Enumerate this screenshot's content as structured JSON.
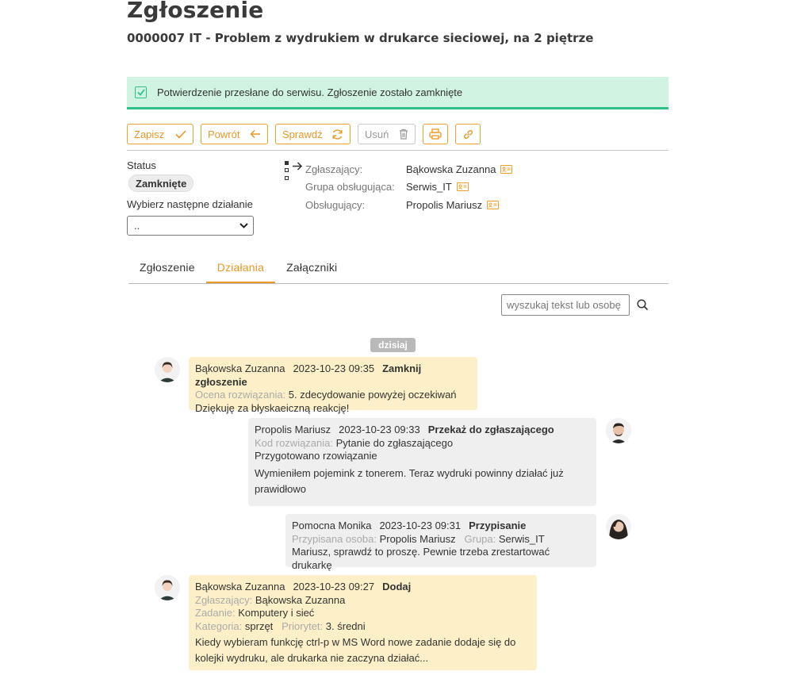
{
  "header": {
    "title": "Zgłoszenie",
    "subtitle": "0000007 IT - Problem z wydrukiem w drukarce sieciowej, na 2 piętrze"
  },
  "alert": {
    "text": "Potwierdzenie przesłane do serwisu. Zgłoszenie zostało zamknięte",
    "color": "#2fc08a"
  },
  "toolbar": {
    "save": "Zapisz",
    "back": "Powrót",
    "check": "Sprawdź",
    "delete": "Usuń",
    "accent": "#f0a030"
  },
  "status": {
    "label": "Status",
    "value": "Zamknięte",
    "next_label": "Wybierz następne działanie",
    "next_value": ".."
  },
  "people": [
    {
      "label": "Zgłaszający:",
      "value": "Bąkowska Zuzanna"
    },
    {
      "label": "Grupa obsługująca:",
      "value": "Serwis_IT"
    },
    {
      "label": "Obsługujący:",
      "value": "Propolis Mariusz"
    }
  ],
  "tabs": [
    "Zgłoszenie",
    "Działania",
    "Załączniki"
  ],
  "search": {
    "placeholder": "wyszukaj tekst lub osobę"
  },
  "timeline": {
    "date_label": "dzisiaj",
    "messages": [
      {
        "author": "Bąkowska Zuzanna",
        "time": "2023-10-23 09:35",
        "action": "Zamknij zgłoszenie",
        "l1_label": "Ocena rozwiązania:",
        "l1_value": "5. zdecydowanie powyżej oczekiwań",
        "body": "Dziękuję za błyskaeiczną reakcję!"
      },
      {
        "author": "Propolis Mariusz",
        "time": "2023-10-23 09:33",
        "action": "Przekaż do zgłaszającego",
        "l1_label": "Kod rozwiązania:",
        "l1_value": "Pytanie do zgłaszającego",
        "l2": "Przygotowano rzowiązanie",
        "body": "Wymieniłem pojemink z tonerem. Teraz wydruki powinny działać już prawidłowo"
      },
      {
        "author": "Pomocna Monika",
        "time": "2023-10-23 09:31",
        "action": "Przypisanie",
        "l1_label": "Przypisana osoba:",
        "l1_value": "Propolis Mariusz",
        "l1b_label": "Grupa:",
        "l1b_value": "Serwis_IT",
        "body": "Mariusz, sprawdź to proszę. Pewnie trzeba zrestartować drukarkę"
      },
      {
        "author": "Bąkowska Zuzanna",
        "time": "2023-10-23 09:27",
        "action": "Dodaj",
        "l1_label": "Zgłaszający:",
        "l1_value": "Bąkowska Zuzanna",
        "l2_label": "Zadanie:",
        "l2_value": "Komputery i sieć",
        "l3_label": "Kategoria:",
        "l3_value": "sprzęt",
        "l3b_label": "Priorytet:",
        "l3b_value": "3. średni",
        "body": "Kiedy wybieram funkcję ctrl-p w MS Word nowe zadanie dodaje się do kolejki wydruku, ale drukarka nie zaczyna działać..."
      }
    ]
  }
}
